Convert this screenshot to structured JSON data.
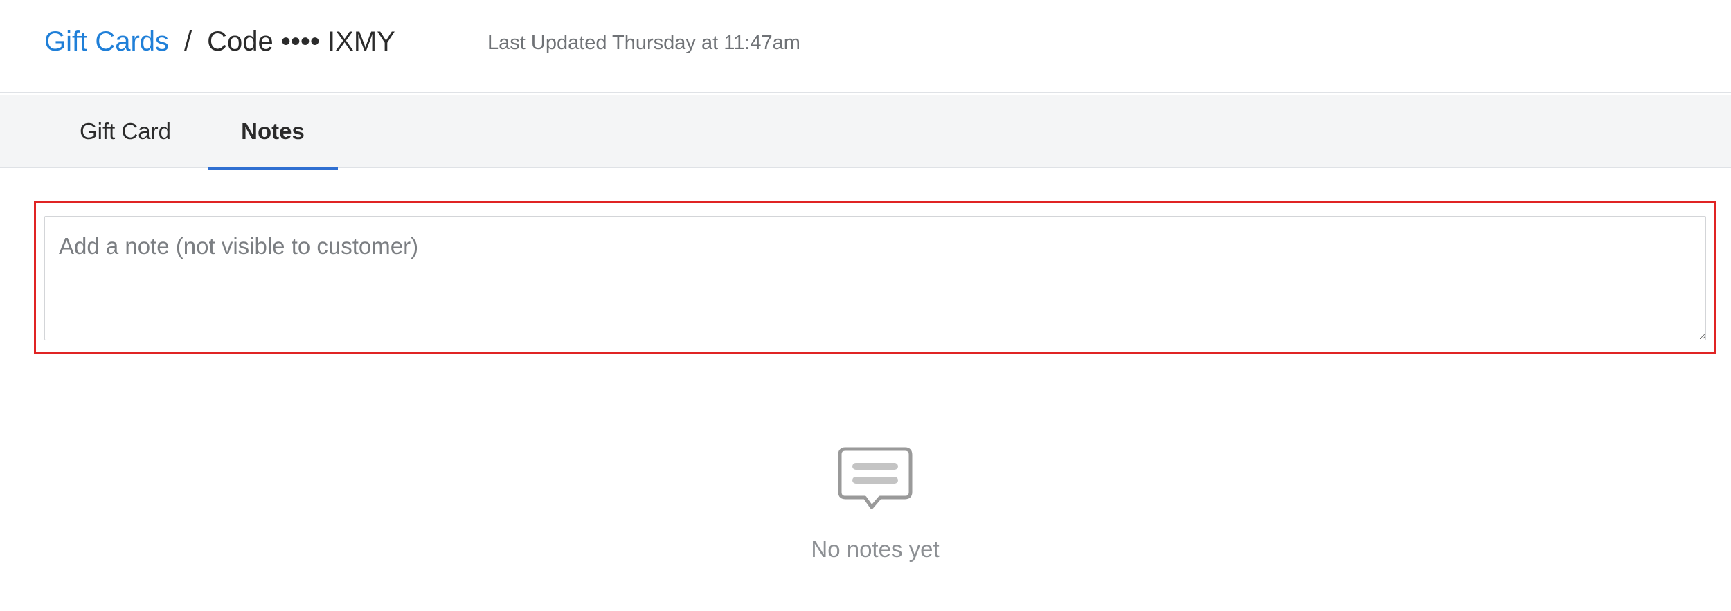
{
  "header": {
    "breadcrumb_parent": "Gift Cards",
    "breadcrumb_separator": "/",
    "breadcrumb_current": "Code •••• IXMY",
    "last_updated": "Last Updated Thursday at 11:47am"
  },
  "tabs": [
    {
      "label": "Gift Card",
      "active": false
    },
    {
      "label": "Notes",
      "active": true
    }
  ],
  "note_input": {
    "placeholder": "Add a note (not visible to customer)",
    "value": ""
  },
  "empty_state": {
    "icon": "speech-bubble-icon",
    "text": "No notes yet"
  },
  "colors": {
    "link": "#1f7fd8",
    "active_tab_underline": "#2f6fd1",
    "highlight_border": "#e02424",
    "tabbar_bg": "#f4f5f6"
  }
}
